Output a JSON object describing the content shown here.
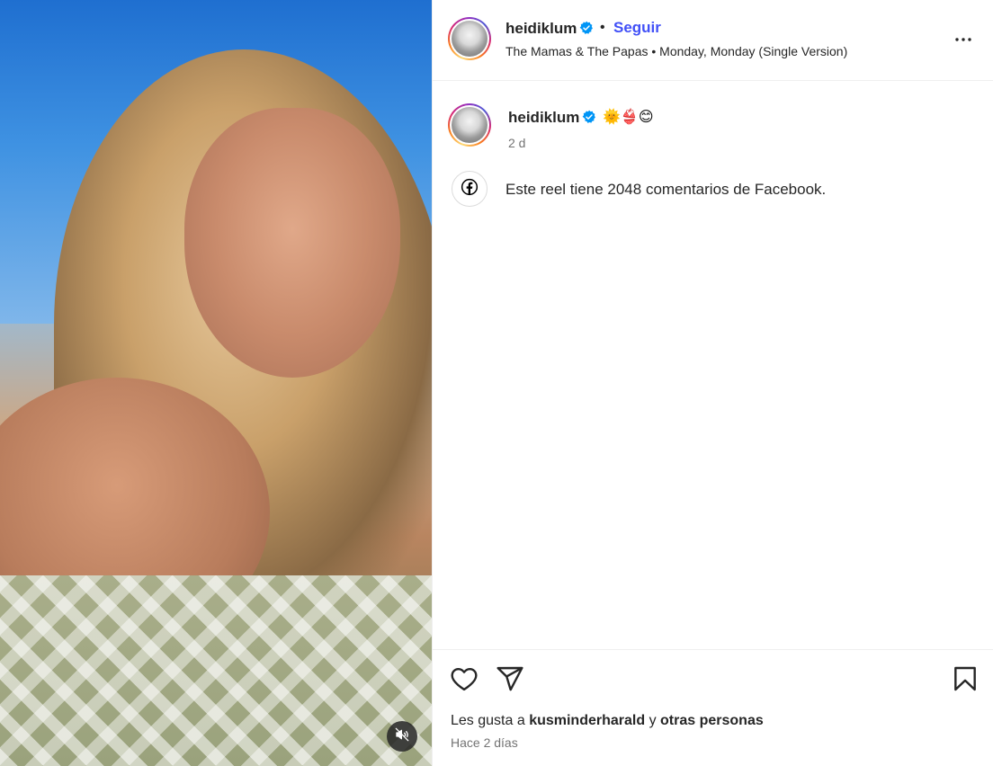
{
  "post": {
    "username": "heidiklum",
    "follow_label": "Seguir",
    "separator": "•",
    "audio": "The Mamas & The Papas • Monday, Monday (Single Version)"
  },
  "caption": {
    "username": "heidiklum",
    "emojis": "🌞👙😊",
    "time": "2 d"
  },
  "facebook_notice": "Este reel tiene 2048 comentarios de Facebook.",
  "likes": {
    "prefix": "Les gusta a",
    "user": "kusminderharald",
    "conjunction": "y",
    "others": "otras personas"
  },
  "posted_ago": "Hace 2 días",
  "icons": {
    "verified": "verified-badge-icon",
    "more": "more-options-icon",
    "facebook": "facebook-icon",
    "like": "heart-icon",
    "share": "send-icon",
    "save": "bookmark-icon",
    "mute": "audio-muted-icon"
  },
  "colors": {
    "follow": "#4150f7",
    "verified": "#0095f6",
    "secondary_text": "#737373"
  }
}
